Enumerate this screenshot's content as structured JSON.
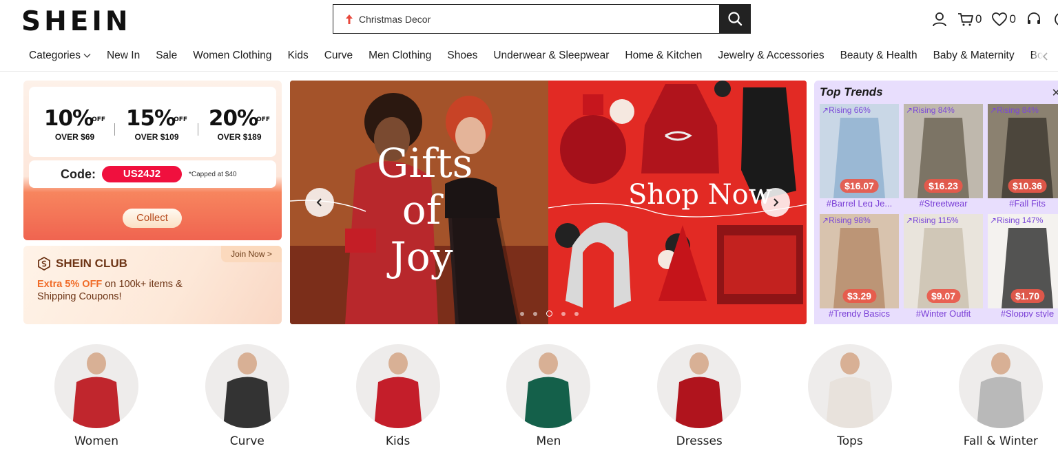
{
  "header": {
    "logo": "SHEIN",
    "search_placeholder": "Christmas Decor",
    "cart_count": "0",
    "wishlist_count": "0"
  },
  "nav": {
    "items": [
      "Categories",
      "New In",
      "Sale",
      "Women Clothing",
      "Kids",
      "Curve",
      "Men Clothing",
      "Shoes",
      "Underwear & Sleepwear",
      "Home & Kitchen",
      "Jewelry & Accessories",
      "Beauty & Health",
      "Baby & Maternity",
      "Bo"
    ]
  },
  "coupon": {
    "tiers": [
      {
        "pct": "10%",
        "off": "OFF",
        "over": "OVER $69"
      },
      {
        "pct": "15%",
        "off": "OFF",
        "over": "OVER $109"
      },
      {
        "pct": "20%",
        "off": "OFF",
        "over": "OVER $189"
      }
    ],
    "code_label": "Code:",
    "code": "US24J2",
    "cap": "*Capped at $40",
    "collect": "Collect"
  },
  "club": {
    "title": "SHEIN CLUB",
    "join": "Join Now >",
    "desc_highlight": "Extra 5% OFF",
    "desc_rest": " on 100k+ items & Shipping Coupons!"
  },
  "banner": {
    "left_line1": "Gifts",
    "left_line2": "of",
    "left_line3": "Joy",
    "right_text": "Shop Now",
    "slide_count": 5,
    "active_slide": 3
  },
  "trends": {
    "title": "Top Trends",
    "items": [
      {
        "rise": "Rising 66%",
        "price": "$16.07",
        "tag": "#Barrel Leg Je..."
      },
      {
        "rise": "Rising 84%",
        "price": "$16.23",
        "tag": "#Streetwear"
      },
      {
        "rise": "Rising 84%",
        "price": "$10.36",
        "tag": "#Fall Fits"
      },
      {
        "rise": "Rising 98%",
        "price": "$3.29",
        "tag": "#Trendy Basics"
      },
      {
        "rise": "Rising 115%",
        "price": "$9.07",
        "tag": "#Winter Outfit"
      },
      {
        "rise": "Rising 147%",
        "price": "$1.70",
        "tag": "#Sloppy style"
      }
    ]
  },
  "categories": [
    "Women",
    "Curve",
    "Kids",
    "Men",
    "Dresses",
    "Tops",
    "Fall & Winter"
  ],
  "colors": {
    "accent_red": "#f0103e",
    "trend_purple": "#7a3fd6",
    "banner_red": "#e22a24"
  }
}
